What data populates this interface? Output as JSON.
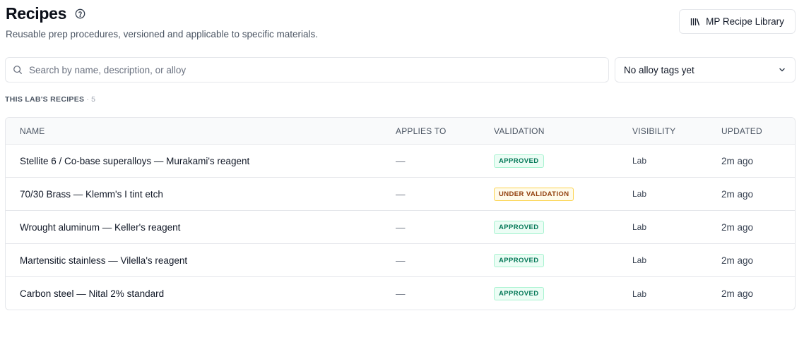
{
  "header": {
    "title": "Recipes",
    "subtitle": "Reusable prep procedures, versioned and applicable to specific materials.",
    "library_button": "MP Recipe Library"
  },
  "filters": {
    "search_placeholder": "Search by name, description, or alloy",
    "search_value": "",
    "alloy_select": "No alloy tags yet"
  },
  "section": {
    "label": "THIS LAB'S RECIPES",
    "separator": "·",
    "count": "5"
  },
  "table": {
    "columns": {
      "name": "NAME",
      "applies_to": "APPLIES TO",
      "validation": "VALIDATION",
      "visibility": "VISIBILITY",
      "updated": "UPDATED"
    },
    "rows": [
      {
        "name": "Stellite 6 / Co-base superalloys — Murakami's reagent",
        "applies_to": "—",
        "validation": "APPROVED",
        "visibility": "Lab",
        "updated": "2m ago"
      },
      {
        "name": "70/30 Brass — Klemm's I tint etch",
        "applies_to": "—",
        "validation": "UNDER VALIDATION",
        "visibility": "Lab",
        "updated": "2m ago"
      },
      {
        "name": "Wrought aluminum — Keller's reagent",
        "applies_to": "—",
        "validation": "APPROVED",
        "visibility": "Lab",
        "updated": "2m ago"
      },
      {
        "name": "Martensitic stainless — Vilella's reagent",
        "applies_to": "—",
        "validation": "APPROVED",
        "visibility": "Lab",
        "updated": "2m ago"
      },
      {
        "name": "Carbon steel — Nital 2% standard",
        "applies_to": "—",
        "validation": "APPROVED",
        "visibility": "Lab",
        "updated": "2m ago"
      }
    ]
  },
  "colors": {
    "approved": "#047857",
    "under_validation": "#92400e",
    "border": "#e5e7eb"
  },
  "icons": {
    "help": "help-circle-icon",
    "library": "library-icon",
    "search": "search-icon",
    "dropdown": "chevron-down-icon"
  }
}
